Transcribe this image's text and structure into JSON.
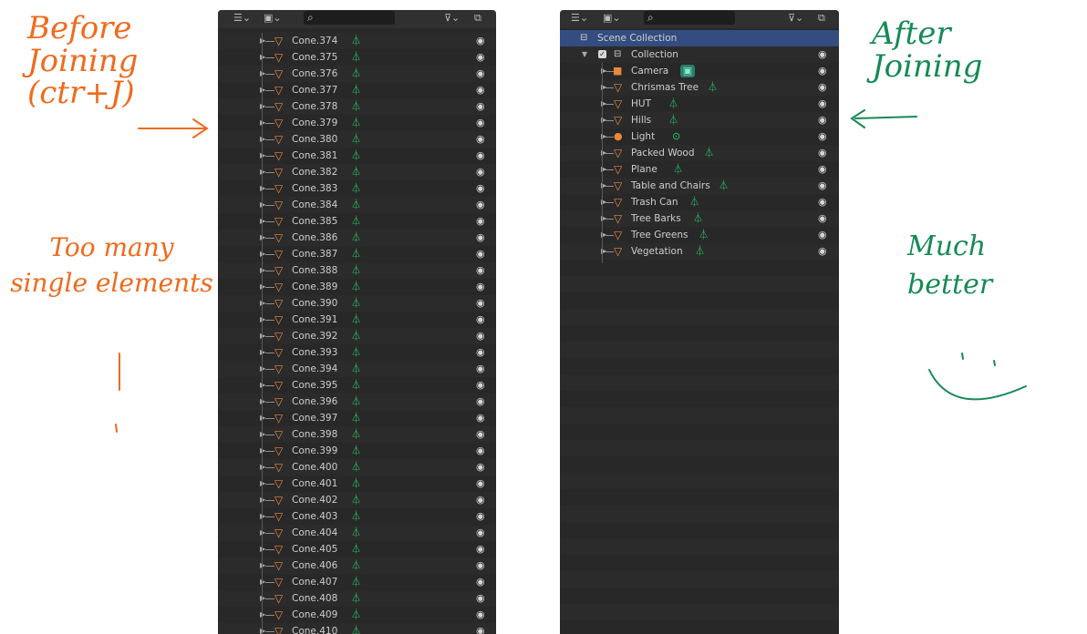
{
  "annotations": {
    "before_joining": "Before\nJoining\n(ctr+J)",
    "too_many": "Too many\nsingle elements",
    "after_joining": "After\nJoining",
    "much_better": "Much\nbetter"
  },
  "left_outliner": {
    "rows": [
      "Cone.374",
      "Cone.375",
      "Cone.376",
      "Cone.377",
      "Cone.378",
      "Cone.379",
      "Cone.380",
      "Cone.381",
      "Cone.382",
      "Cone.383",
      "Cone.384",
      "Cone.385",
      "Cone.386",
      "Cone.387",
      "Cone.388",
      "Cone.389",
      "Cone.390",
      "Cone.391",
      "Cone.392",
      "Cone.393",
      "Cone.394",
      "Cone.395",
      "Cone.396",
      "Cone.397",
      "Cone.398",
      "Cone.399",
      "Cone.400",
      "Cone.401",
      "Cone.402",
      "Cone.403",
      "Cone.404",
      "Cone.405",
      "Cone.406",
      "Cone.407",
      "Cone.408",
      "Cone.409",
      "Cone.410"
    ]
  },
  "right_outliner": {
    "scene_collection": "Scene Collection",
    "collection": "Collection",
    "objects": [
      {
        "name": "Camera",
        "icon": "camera-icon",
        "data_icon": "camera-data-icon"
      },
      {
        "name": "Chrismas Tree",
        "icon": "mesh-object-icon",
        "data_icon": "mesh-data-icon"
      },
      {
        "name": "HUT",
        "icon": "mesh-object-icon",
        "data_icon": "mesh-data-icon"
      },
      {
        "name": "Hills",
        "icon": "mesh-object-icon",
        "data_icon": "mesh-data-icon"
      },
      {
        "name": "Light",
        "icon": "light-icon",
        "data_icon": "light-data-icon"
      },
      {
        "name": "Packed Wood",
        "icon": "mesh-object-icon",
        "data_icon": "mesh-data-icon"
      },
      {
        "name": "Plane",
        "icon": "mesh-object-icon",
        "data_icon": "mesh-data-icon"
      },
      {
        "name": "Table and Chairs",
        "icon": "mesh-object-icon",
        "data_icon": "mesh-data-icon"
      },
      {
        "name": "Trash Can",
        "icon": "mesh-object-icon",
        "data_icon": "mesh-data-icon"
      },
      {
        "name": "Tree Barks",
        "icon": "mesh-object-icon",
        "data_icon": "mesh-data-icon"
      },
      {
        "name": "Tree Greens",
        "icon": "mesh-object-icon",
        "data_icon": "mesh-data-icon"
      },
      {
        "name": "Vegetation",
        "icon": "mesh-object-icon",
        "data_icon": "mesh-data-icon"
      }
    ]
  },
  "colors": {
    "annotation_orange": "#f06a1c",
    "annotation_green": "#168a55",
    "mesh_object": "#e8893b",
    "mesh_data": "#2ccf6f",
    "selected_row": "#334d80"
  }
}
